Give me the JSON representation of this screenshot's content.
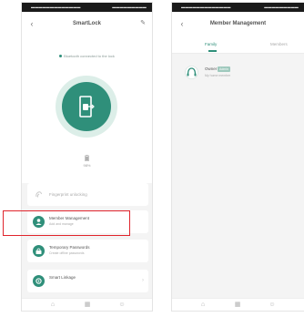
{
  "left_screen": {
    "status_bar": {
      "left": "▬▬▬▬▬▬▬▬▬▬▬▬▬",
      "right": "▬▬▬▬▬▬▬▬▬"
    },
    "title": "SmartLock",
    "connection_hint": "Bluetooth connected to the lock",
    "battery": "98%",
    "menu": [
      {
        "label": "Fingerprint unlocking",
        "sub": "",
        "disabled": true
      },
      {
        "label": "Member Management",
        "sub": "Add and manage",
        "disabled": false
      },
      {
        "label": "Temporary Passwords",
        "sub": "Create offline passwords",
        "disabled": false
      },
      {
        "label": "Smart Linkage",
        "sub": "",
        "disabled": false
      }
    ],
    "nav": [
      "⌂",
      "▦",
      "☺"
    ]
  },
  "right_screen": {
    "status_bar": {
      "left": "▬▬▬▬▬▬▬▬▬▬▬▬▬",
      "right": "▬▬▬▬▬▬▬▬▬"
    },
    "title": "Member Management",
    "tabs": [
      "Family",
      "Members"
    ],
    "member": {
      "name": "Owner",
      "role": "Admin",
      "sub": "My home member"
    },
    "nav": [
      "⌂",
      "▦",
      "☺"
    ]
  },
  "colors": {
    "accent": "#2f8f7a",
    "highlight": "#e0242c"
  }
}
